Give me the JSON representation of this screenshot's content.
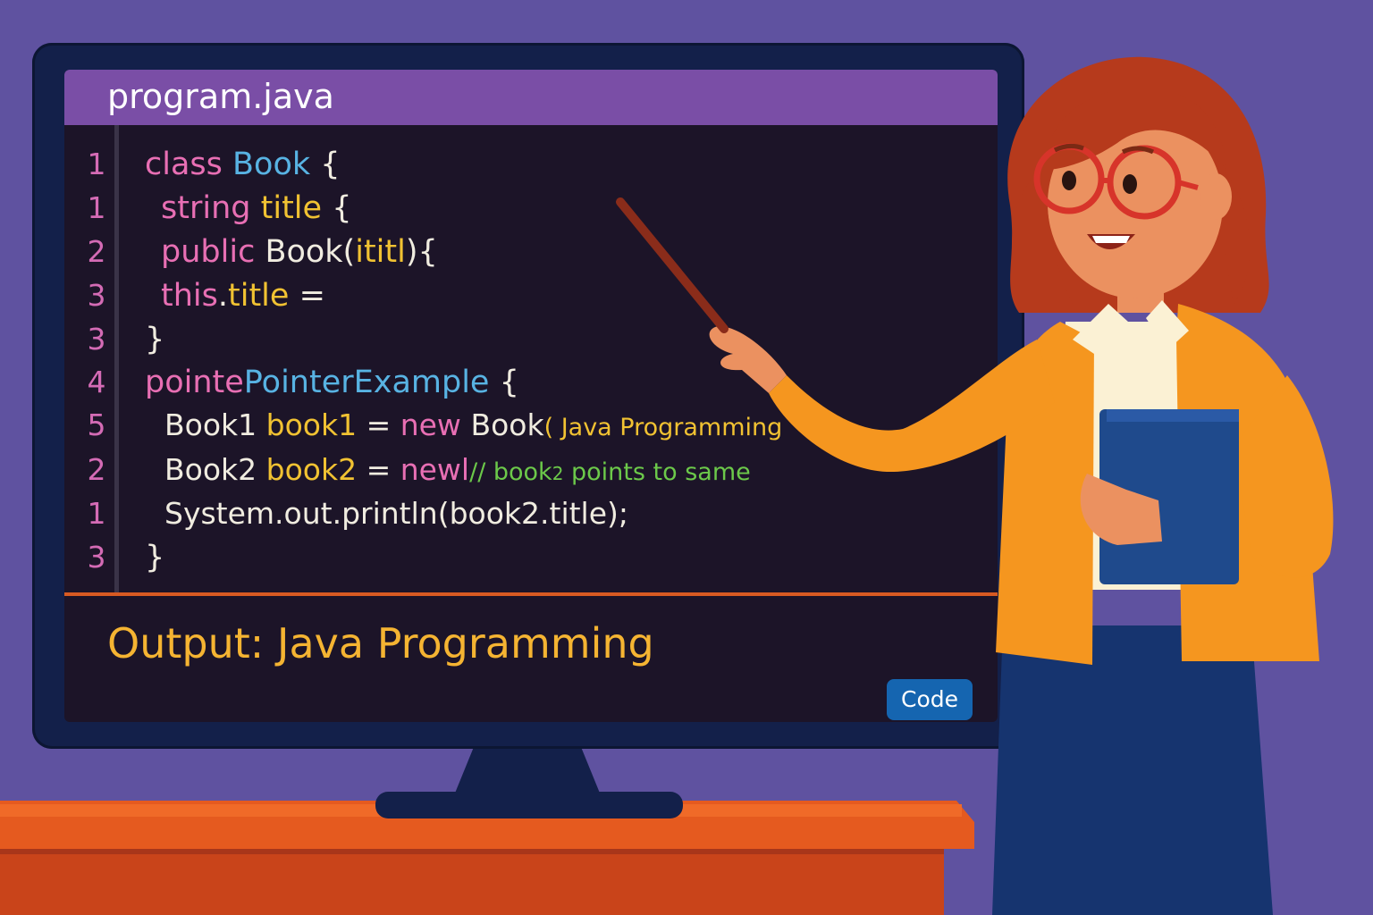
{
  "editor": {
    "filename": "program.java",
    "line_numbers": [
      "1",
      "1",
      "2",
      "3",
      "3",
      "4",
      "5",
      "2",
      "1",
      "3"
    ],
    "code": {
      "l1": {
        "kw": "class",
        "cls": "Book",
        "rest": "{"
      },
      "l2": {
        "kw": "string",
        "id": "title",
        "rest": "{"
      },
      "l3": {
        "kw": "public",
        "pl": "Book(",
        "id": "ititl",
        "rest": "){"
      },
      "l4": {
        "kw": "this",
        "rest1": ".",
        "id": "title",
        "rest2": "="
      },
      "l5": {
        "rest": "}"
      },
      "l6": {
        "kw": "pointe",
        "cls": "PointerExample",
        "rest": "{"
      },
      "l7": {
        "pl": "Book1",
        "id": "book1",
        "eq": "=",
        "kw": "new",
        "pl2": "Book",
        "str": "( Java Programming"
      },
      "l8": {
        "pl": "Book2",
        "id": "book2",
        "eq": "=",
        "kw": "newl",
        "comment1": "// book",
        "comment_small": "2",
        "comment2": " points to same"
      },
      "l9": {
        "pl": "System.out.println(book2.title);"
      },
      "l10": {
        "rest": "}"
      }
    },
    "output": "Output: Java Programming",
    "code_button": "Code"
  },
  "colors": {
    "background": "#5f52a0",
    "title_bar": "#7a4ea6",
    "screen": "#1c1428",
    "keyword": "#e86fb4",
    "class_name": "#58b3e3",
    "identifier": "#f1c232",
    "comment": "#6cc94a",
    "output": "#f5b432",
    "button": "#1565b0"
  },
  "illustration": {
    "subject": "teacher-with-pointer",
    "props": [
      "desk",
      "book",
      "pointer-stick",
      "glasses"
    ]
  }
}
